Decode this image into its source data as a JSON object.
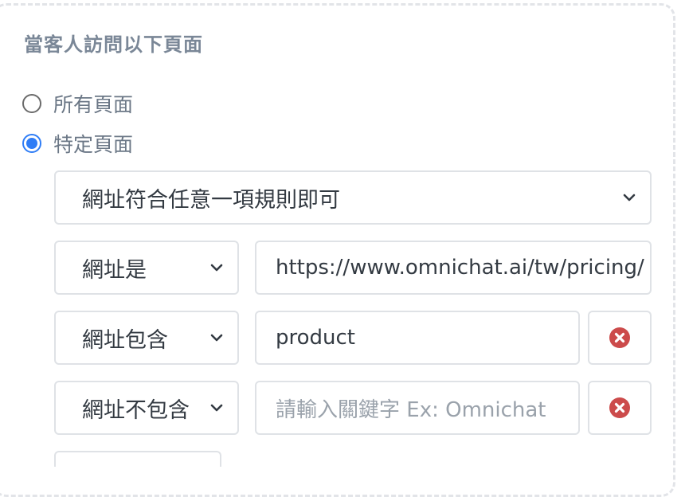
{
  "section": {
    "title": "當客人訪問以下頁面"
  },
  "radios": [
    {
      "label": "所有頁面",
      "checked": false
    },
    {
      "label": "特定頁面",
      "checked": true
    }
  ],
  "match_mode": {
    "value": "網址符合任意一項規則即可"
  },
  "rules": [
    {
      "condition": "網址是",
      "value": "https://www.omnichat.ai/tw/pricing/",
      "placeholder": ""
    },
    {
      "condition": "網址包含",
      "value": "product",
      "placeholder": ""
    },
    {
      "condition": "網址不包含",
      "value": "",
      "placeholder": "請輸入關鍵字 Ex: Omnichat"
    }
  ],
  "icons": {
    "chevron": "chevron-down-icon",
    "delete": "close-circle-icon"
  },
  "colors": {
    "radio_accent": "#2f7df6",
    "delete_red": "#cc4b4b",
    "title": "#7a8797"
  }
}
